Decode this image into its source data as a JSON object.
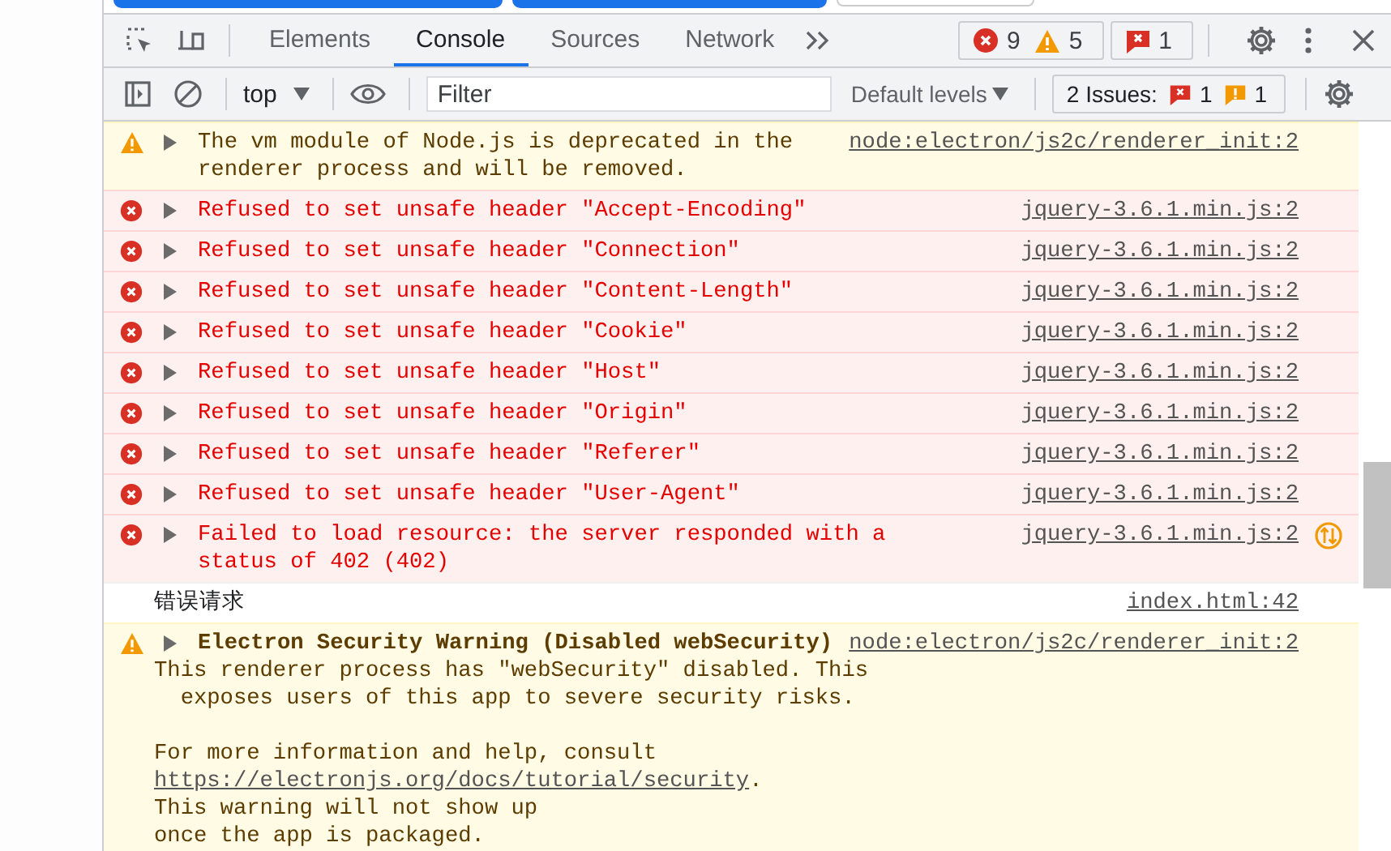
{
  "tabs": [
    {
      "label": "Elements",
      "selected": false
    },
    {
      "label": "Console",
      "selected": true
    },
    {
      "label": "Sources",
      "selected": false
    },
    {
      "label": "Network",
      "selected": false
    }
  ],
  "counters": {
    "errors": "9",
    "warnings": "5",
    "issues": "1"
  },
  "toolbar": {
    "context": "top",
    "filter_placeholder": "Filter",
    "levels": "Default levels",
    "issues_label": "2 Issues:",
    "issue_errors": "1",
    "issue_warnings": "1"
  },
  "messages": [
    {
      "kind": "warning",
      "expandable": true,
      "lines": [
        "The vm module of Node.js is deprecated in the",
        "renderer process and will be removed."
      ],
      "source": "node:electron/js2c/renderer_init:2"
    },
    {
      "kind": "error",
      "expandable": true,
      "lines": [
        "Refused to set unsafe header \"Accept-Encoding\""
      ],
      "source": "jquery-3.6.1.min.js:2"
    },
    {
      "kind": "error",
      "expandable": true,
      "lines": [
        "Refused to set unsafe header \"Connection\""
      ],
      "source": "jquery-3.6.1.min.js:2"
    },
    {
      "kind": "error",
      "expandable": true,
      "lines": [
        "Refused to set unsafe header \"Content-Length\""
      ],
      "source": "jquery-3.6.1.min.js:2"
    },
    {
      "kind": "error",
      "expandable": true,
      "lines": [
        "Refused to set unsafe header \"Cookie\""
      ],
      "source": "jquery-3.6.1.min.js:2"
    },
    {
      "kind": "error",
      "expandable": true,
      "lines": [
        "Refused to set unsafe header \"Host\""
      ],
      "source": "jquery-3.6.1.min.js:2"
    },
    {
      "kind": "error",
      "expandable": true,
      "lines": [
        "Refused to set unsafe header \"Origin\""
      ],
      "source": "jquery-3.6.1.min.js:2"
    },
    {
      "kind": "error",
      "expandable": true,
      "lines": [
        "Refused to set unsafe header \"Referer\""
      ],
      "source": "jquery-3.6.1.min.js:2"
    },
    {
      "kind": "error",
      "expandable": true,
      "lines": [
        "Refused to set unsafe header \"User-Agent\""
      ],
      "source": "jquery-3.6.1.min.js:2"
    },
    {
      "kind": "error",
      "expandable": true,
      "network": true,
      "lines": [
        "Failed to load resource: the server responded with a",
        "status of 402 (402)"
      ],
      "source": "jquery-3.6.1.min.js:2"
    },
    {
      "kind": "log",
      "expandable": false,
      "lines": [
        "错误请求"
      ],
      "source": "index.html:42"
    },
    {
      "kind": "warning",
      "expandable": true,
      "title": "Electron Security Warning (Disabled webSecurity)",
      "source": "node:electron/js2c/renderer_init:2",
      "body": [
        {
          "kind": "text",
          "text": "This renderer process has \"webSecurity\" disabled. This"
        },
        {
          "kind": "text",
          "text": "  exposes users of this app to severe security risks."
        },
        {
          "kind": "blank"
        },
        {
          "kind": "text",
          "text": "For more information and help, consult"
        },
        {
          "kind": "link",
          "text": "https://electronjs.org/docs/tutorial/security",
          "after": "."
        },
        {
          "kind": "text",
          "text": "This warning will not show up"
        },
        {
          "kind": "text",
          "text": "once the app is packaged."
        }
      ]
    }
  ]
}
